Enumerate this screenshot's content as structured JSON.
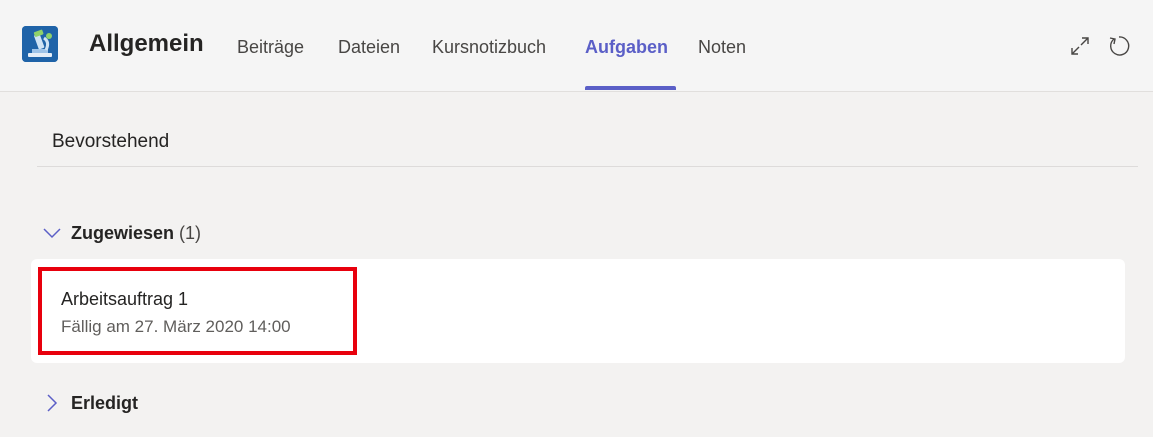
{
  "header": {
    "team_name": "Allgemein",
    "tabs": [
      {
        "label": "Beiträge",
        "active": false
      },
      {
        "label": "Dateien",
        "active": false
      },
      {
        "label": "Kursnotizbuch",
        "active": false
      },
      {
        "label": "Aufgaben",
        "active": true
      },
      {
        "label": "Noten",
        "active": false
      }
    ],
    "accent_color": "#5b5fc7",
    "team_logo_icon": "microscope-icon",
    "actions": [
      {
        "icon": "expand-icon"
      },
      {
        "icon": "refresh-icon"
      }
    ]
  },
  "main": {
    "section_title": "Bevorstehend",
    "groups": [
      {
        "label": "Zugewiesen",
        "count": "(1)",
        "expanded": true,
        "items": [
          {
            "title": "Arbeitsauftrag 1",
            "due": "Fällig am 27. März 2020 14:00"
          }
        ]
      },
      {
        "label": "Erledigt",
        "expanded": false
      }
    ],
    "highlight_color": "#e8000d"
  }
}
